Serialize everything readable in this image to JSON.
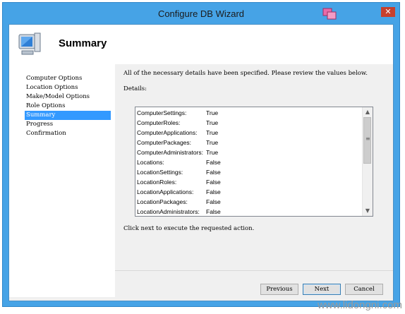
{
  "window": {
    "title": "Configure DB Wizard",
    "close_glyph": "✕"
  },
  "header": {
    "title": "Summary",
    "icon": "computer-icon"
  },
  "nav": {
    "items": [
      {
        "label": "Computer Options",
        "active": false
      },
      {
        "label": "Location Options",
        "active": false
      },
      {
        "label": "Make/Model Options",
        "active": false
      },
      {
        "label": "Role Options",
        "active": false
      },
      {
        "label": "Summary",
        "active": true
      },
      {
        "label": "Progress",
        "active": false
      },
      {
        "label": "Confirmation",
        "active": false
      }
    ]
  },
  "content": {
    "intro": "All of the necessary details have been specified.  Please review the values below.",
    "details_label": "Details:",
    "details": [
      {
        "key": "ComputerSettings:",
        "value": "True"
      },
      {
        "key": "ComputerRoles:",
        "value": "True"
      },
      {
        "key": "ComputerApplications:",
        "value": "True"
      },
      {
        "key": "ComputerPackages:",
        "value": "True"
      },
      {
        "key": "ComputerAdministrators:",
        "value": "True"
      },
      {
        "key": "Locations:",
        "value": "False"
      },
      {
        "key": "LocationSettings:",
        "value": "False"
      },
      {
        "key": "LocationRoles:",
        "value": "False"
      },
      {
        "key": "LocationApplications:",
        "value": "False"
      },
      {
        "key": "LocationPackages:",
        "value": "False"
      },
      {
        "key": "LocationAdministrators:",
        "value": "False"
      }
    ],
    "footer_note": "Click next to execute the requested action."
  },
  "buttons": {
    "previous": "Previous",
    "next": "Next",
    "cancel": "Cancel"
  },
  "watermark": "www.lidongni.com",
  "colors": {
    "title_bar": "#46a3e6",
    "selection": "#3399ff",
    "close": "#c7402d"
  }
}
